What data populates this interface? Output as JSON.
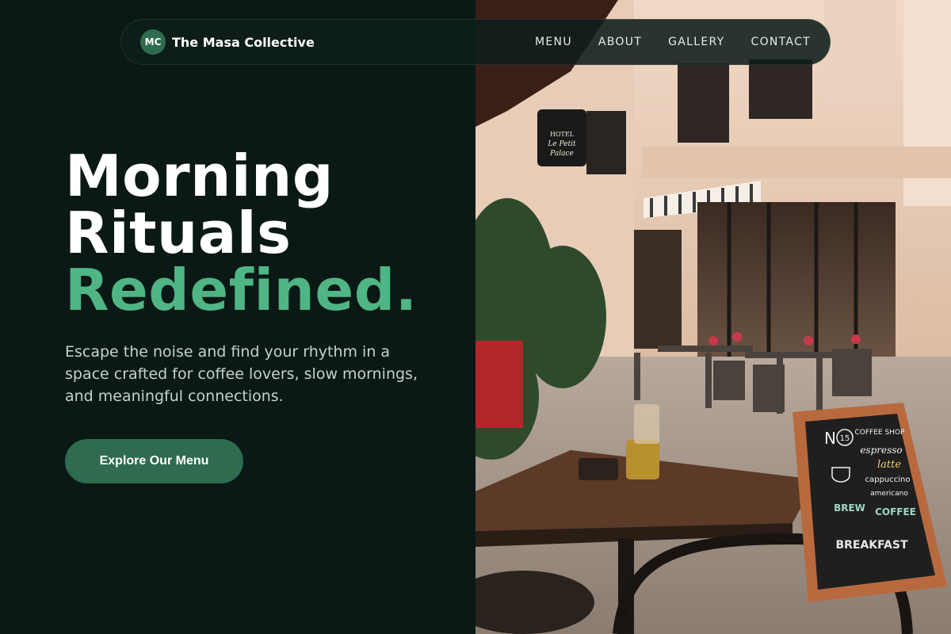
{
  "brand": {
    "badge": "MC",
    "name": "The Masa Collective"
  },
  "nav": {
    "items": [
      "MENU",
      "ABOUT",
      "GALLERY",
      "CONTACT"
    ]
  },
  "hero": {
    "line1": "Morning",
    "line2": "Rituals",
    "accent": "Redefined.",
    "subtitle": "Escape the noise and find your rhythm in a space crafted for coffee lovers, slow mornings, and meaningful connections.",
    "cta_label": "Explore Our Menu"
  },
  "photo": {
    "hotel_sign": [
      "HOTEL",
      "Le Petit",
      "Palace"
    ],
    "chalkboard": [
      "N",
      "15",
      "COFFEE SHOP",
      "espresso",
      "latte",
      "cappuccino",
      "americano",
      "BREW",
      "COFFEE",
      "BREAKFAST"
    ]
  },
  "colors": {
    "background": "#0a1915",
    "accent": "#4fb584",
    "button": "#2e6b4f"
  }
}
